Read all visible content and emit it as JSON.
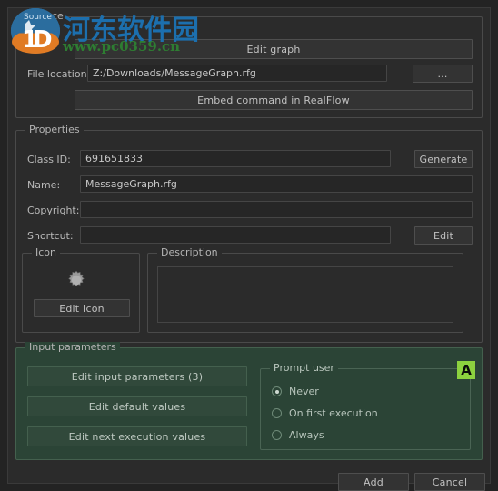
{
  "window": {
    "bg_color": "#232323",
    "panel_color": "#2b2b2b",
    "accent_green": "#2b4436",
    "badge_color": "#8cd13f"
  },
  "source": {
    "legend": "Source",
    "edit_graph_button": "Edit graph",
    "file_location_label": "File location:",
    "file_location_value": "Z:/Downloads/MessageGraph.rfg",
    "browse_button": "...",
    "embed_button": "Embed command in RealFlow"
  },
  "properties": {
    "legend": "Properties",
    "class_id_label": "Class ID:",
    "class_id_value": "691651833",
    "generate_button": "Generate",
    "name_label": "Name:",
    "name_value": "MessageGraph.rfg",
    "copyright_label": "Copyright:",
    "copyright_value": "",
    "shortcut_label": "Shortcut:",
    "shortcut_value": "",
    "edit_button": "Edit",
    "icon": {
      "legend": "Icon",
      "glyph_name": "gear-icon",
      "edit_icon_button": "Edit Icon"
    },
    "description": {
      "legend": "Description",
      "value": ""
    }
  },
  "input_parameters": {
    "legend": "Input parameters",
    "edit_input_parameters_button": "Edit input parameters (3)",
    "edit_default_values_button": "Edit default values",
    "edit_next_execution_values_button": "Edit next execution values",
    "prompt_user": {
      "legend": "Prompt user",
      "options": [
        {
          "label": "Never",
          "selected": true
        },
        {
          "label": "On first execution",
          "selected": false
        },
        {
          "label": "Always",
          "selected": false
        }
      ]
    },
    "hint_badge": "A"
  },
  "footer": {
    "add_button": "Add",
    "cancel_button": "Cancel"
  },
  "watermark": {
    "site_name_cn": "河东软件园",
    "site_url": "www.pc0359.cn",
    "logo_text": "1D"
  }
}
